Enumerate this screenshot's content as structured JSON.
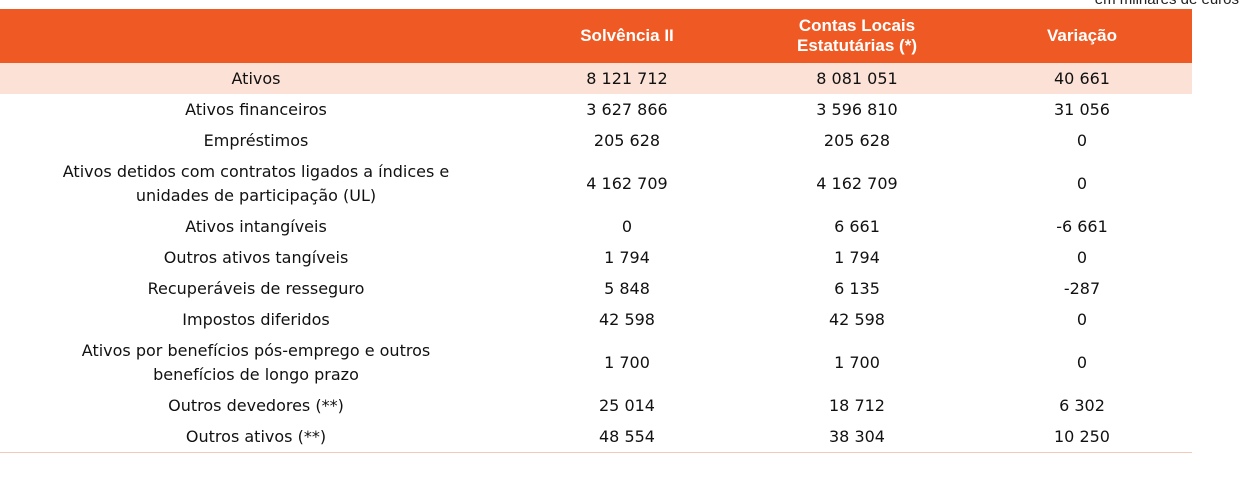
{
  "unit_note": "em milhares de euros",
  "header": {
    "col_label": "",
    "col2": "Solvência II",
    "col3_line1": "Contas Locais",
    "col3_line2": "Estatutárias (*)",
    "col4": "Variação"
  },
  "rows": [
    {
      "label": "Ativos",
      "solvencia": "8 121 712",
      "contas": "8 081 051",
      "variacao": "40 661",
      "highlight": true
    },
    {
      "label": "Ativos financeiros",
      "solvencia": "3 627 866",
      "contas": "3 596 810",
      "variacao": "31 056"
    },
    {
      "label": "Empréstimos",
      "solvencia": "205 628",
      "contas": "205 628",
      "variacao": "0"
    },
    {
      "label_line1": "Ativos detidos com contratos ligados a índices e",
      "label_line2": "unidades de participação (UL)",
      "solvencia": "4 162 709",
      "contas": "4 162 709",
      "variacao": "0"
    },
    {
      "label": "Ativos intangíveis",
      "solvencia": "0",
      "contas": "6 661",
      "variacao": "-6 661"
    },
    {
      "label": "Outros ativos tangíveis",
      "solvencia": "1 794",
      "contas": "1 794",
      "variacao": "0"
    },
    {
      "label": "Recuperáveis de resseguro",
      "solvencia": "5 848",
      "contas": "6 135",
      "variacao": "-287"
    },
    {
      "label": "Impostos diferidos",
      "solvencia": "42 598",
      "contas": "42 598",
      "variacao": "0"
    },
    {
      "label_line1": "Ativos por benefícios pós-emprego e outros",
      "label_line2": "benefícios de longo prazo",
      "solvencia": "1 700",
      "contas": "1 700",
      "variacao": "0"
    },
    {
      "label": "Outros devedores (**)",
      "solvencia": "25 014",
      "contas": "18 712",
      "variacao": "6 302"
    },
    {
      "label": "Outros ativos (**)",
      "solvencia": "48 554",
      "contas": "38 304",
      "variacao": "10 250"
    }
  ]
}
